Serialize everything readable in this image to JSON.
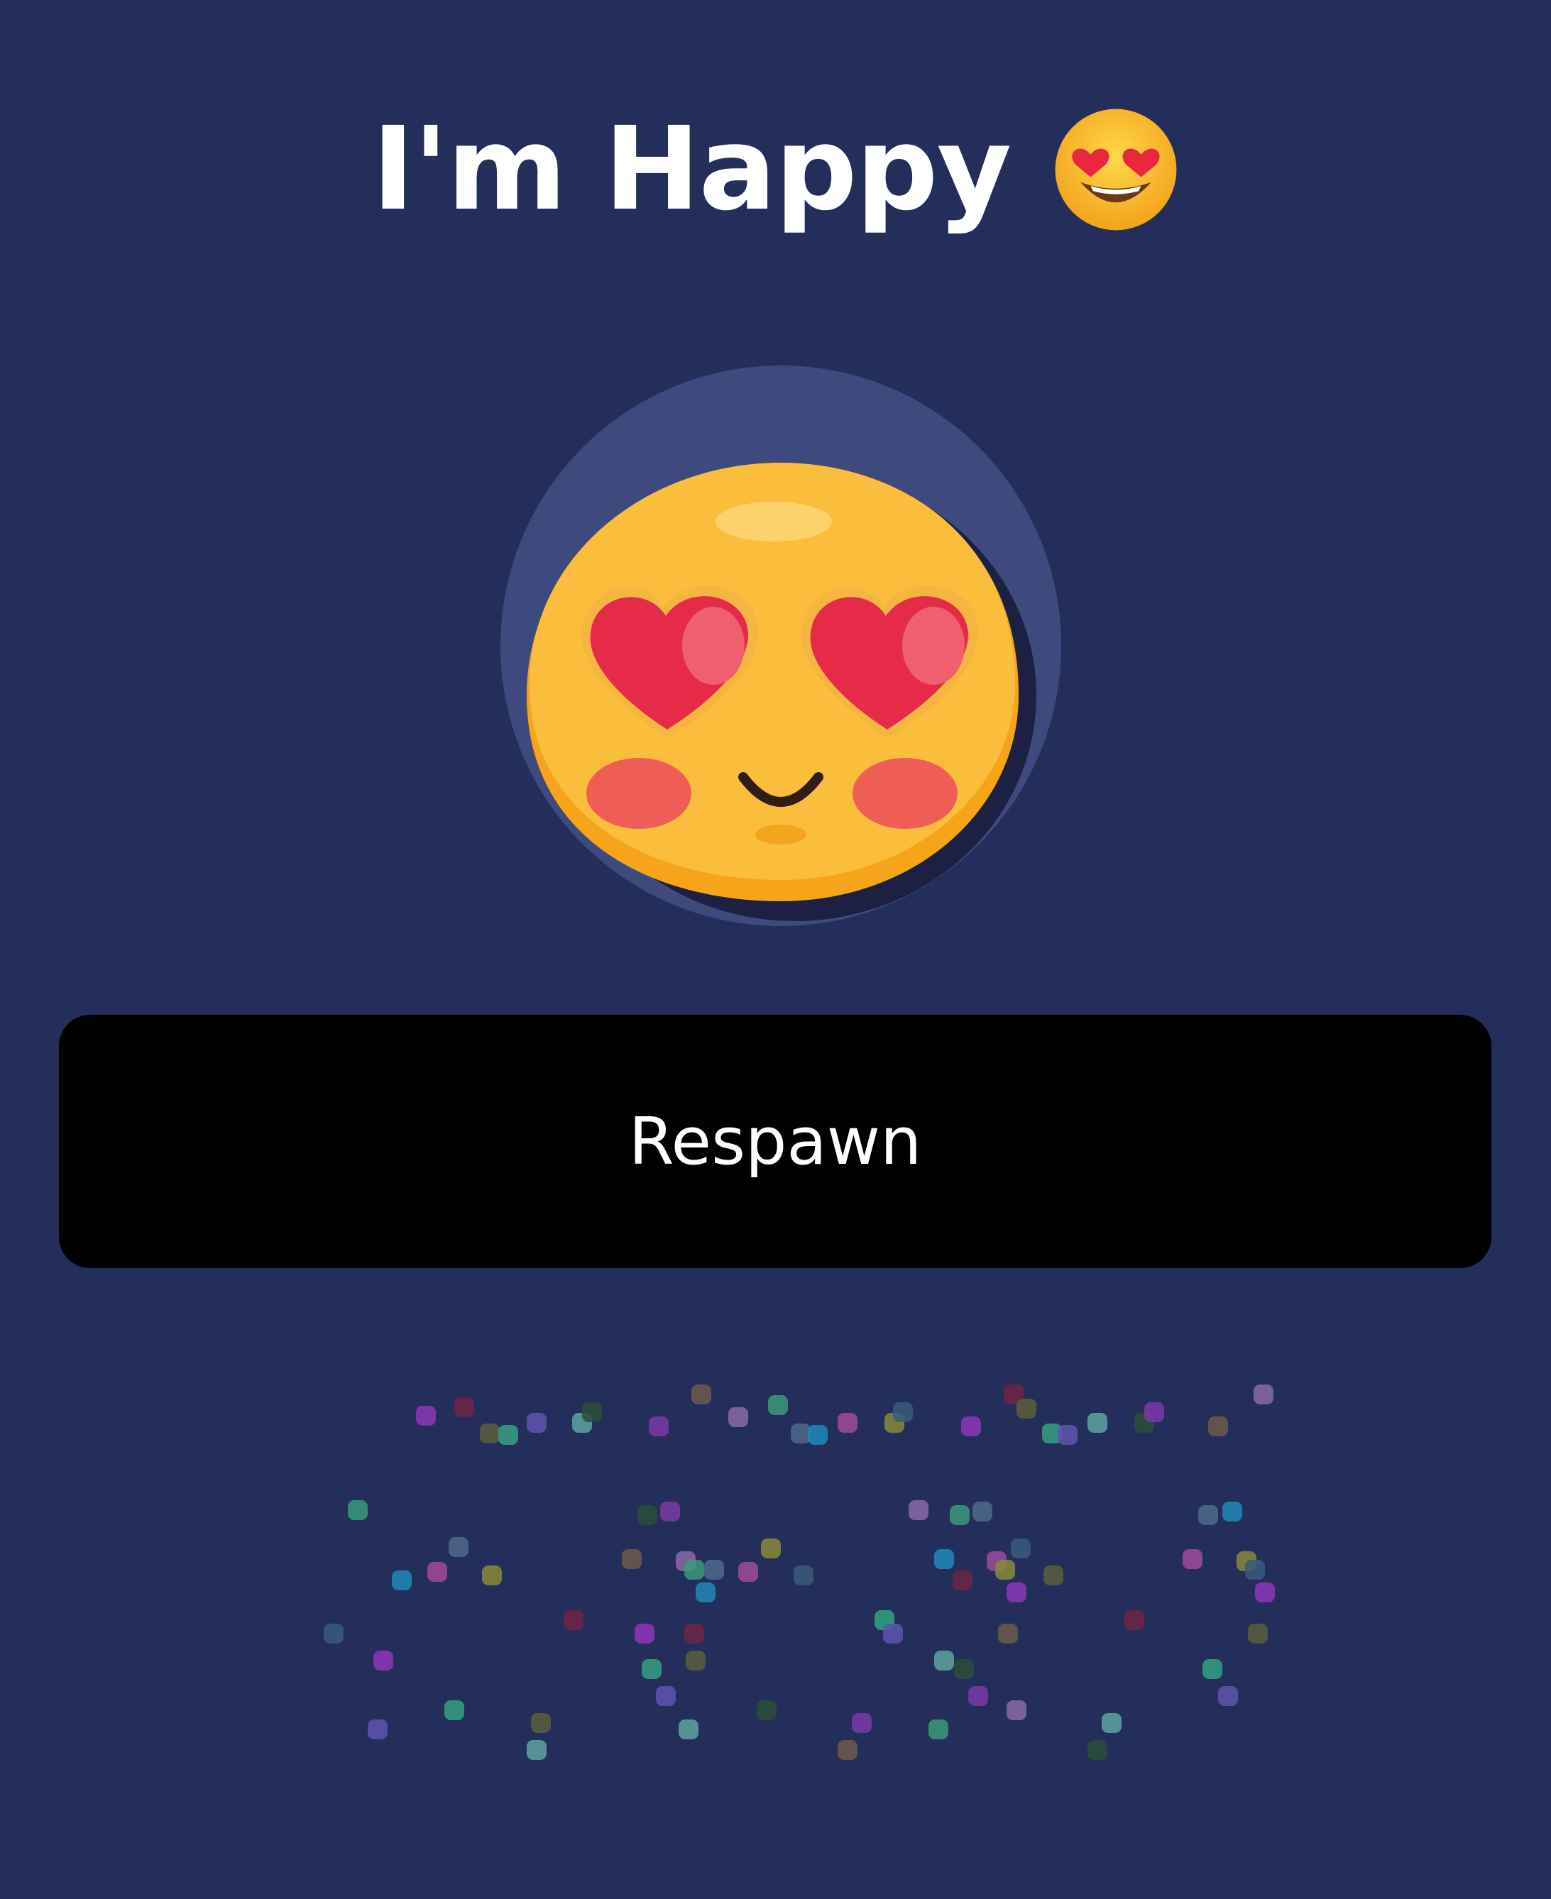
{
  "header": {
    "title": "I'm Happy",
    "emoji_icon": "heart-eyes-emoji-icon"
  },
  "mascot": {
    "icon": "heart-eyes-blob-icon",
    "colors": {
      "face": "#fbbd3c",
      "eyes": "#e52b48",
      "cheeks": "#ee5e55",
      "halo": "#3e4a7e"
    }
  },
  "actions": {
    "respawn_label": "Respawn"
  },
  "theme": {
    "background": "#242e5a",
    "button": "#000000"
  }
}
